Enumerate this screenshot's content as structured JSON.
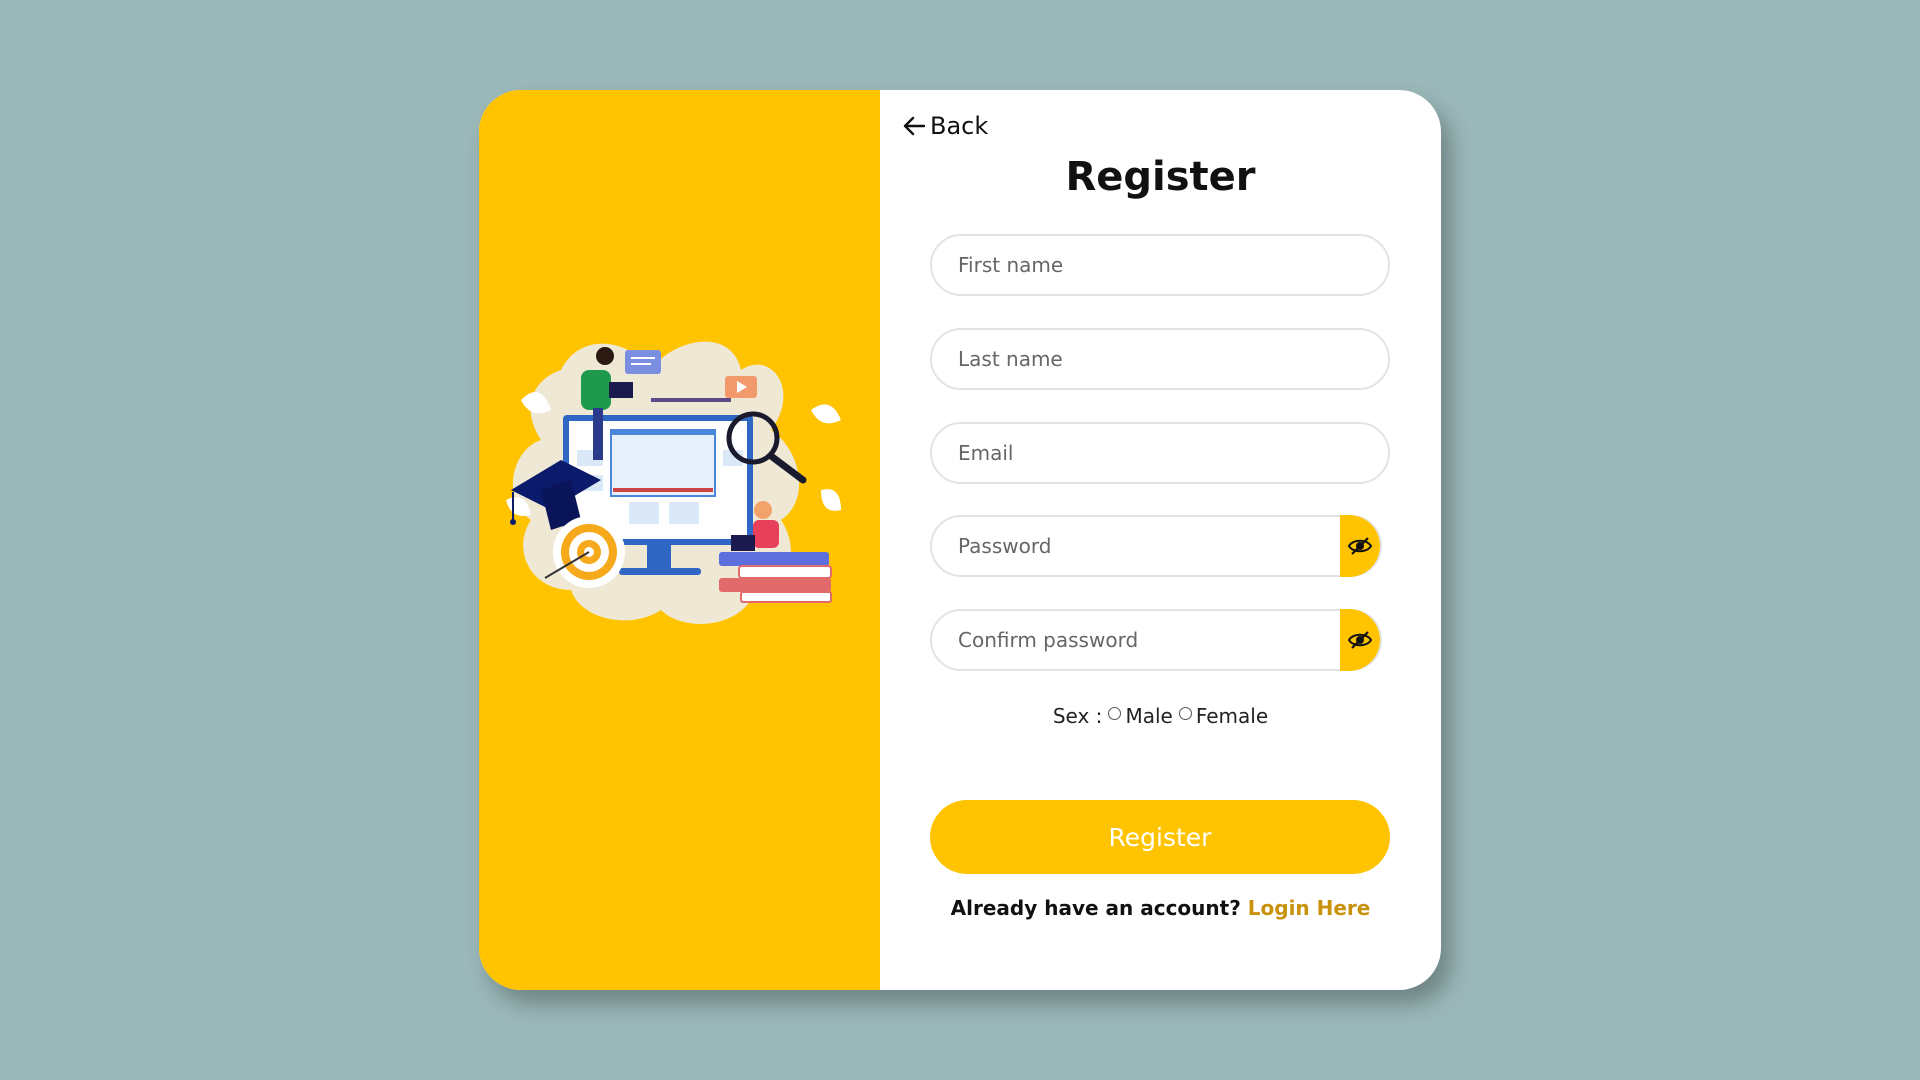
{
  "back": {
    "label": "Back",
    "icon": "arrow-left-icon"
  },
  "form": {
    "title": "Register",
    "first_name_placeholder": "First name",
    "last_name_placeholder": "Last name",
    "email_placeholder": "Email",
    "password_placeholder": "Password",
    "confirm_password_placeholder": "Confirm password",
    "toggle_icon": "eye-slash-icon",
    "sex_label": "Sex :",
    "sex_options": [
      "Male",
      "Female"
    ],
    "submit_label": "Register",
    "login_prompt": "Already have an account?",
    "login_link": "Login Here"
  },
  "colors": {
    "accent": "#ffc300",
    "background": "#9bb8b9",
    "link": "#c9920c"
  }
}
